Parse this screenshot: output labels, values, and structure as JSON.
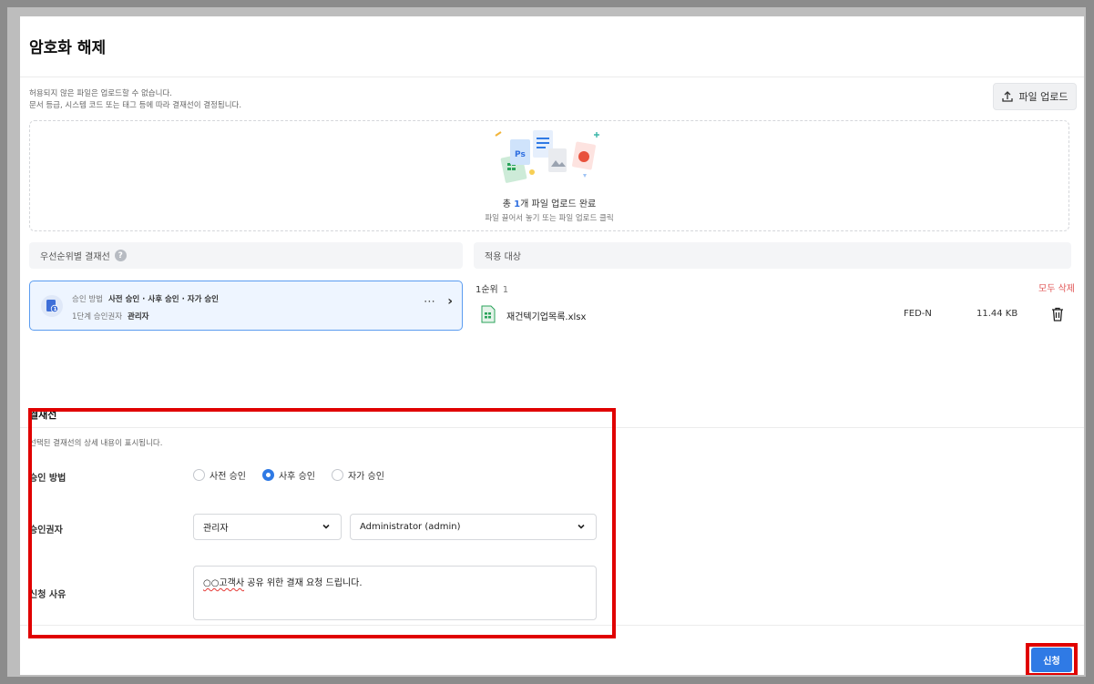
{
  "page": {
    "title": "암호화 해제",
    "notice_line1": "허용되지 않은 파일은 업로드할 수 없습니다.",
    "notice_line2": "문서 등급, 시스템 코드 또는 태그 등에 따라 결재선이 결정됩니다.",
    "upload_button": "파일 업로드"
  },
  "dropzone": {
    "status_prefix": "총 ",
    "status_count": "1",
    "status_suffix": "개 파일 업로드 완료",
    "hint": "파일 끌어서 놓기 또는 파일 업로드 클릭"
  },
  "approval_panel": {
    "header": "우선순위별 결재선",
    "card": {
      "method_label": "승인 방법",
      "method_value": "사전 승인 · 사후 승인 · 자가 승인",
      "approver_label": "1단계 승인권자",
      "approver_value": "관리자"
    }
  },
  "target_panel": {
    "header": "적용 대상",
    "rank_label": "1순위",
    "rank_count": "1",
    "delete_all": "모두 삭제",
    "files": [
      {
        "name": "재건텍기업목록.xlsx",
        "class": "FED-N",
        "size": "11.44 KB"
      }
    ]
  },
  "approval_line": {
    "title": "결재선",
    "description": "선택된 결재선의 상세 내용이 표시됩니다.",
    "method_label": "승인 방법",
    "methods": [
      {
        "label": "사전 승인",
        "selected": false
      },
      {
        "label": "사후 승인",
        "selected": true
      },
      {
        "label": "자가 승인",
        "selected": false
      }
    ],
    "approver_label": "승인권자",
    "approver_role": "관리자",
    "approver_user": "Administrator (admin)",
    "reason_label": "신청 사유",
    "reason_underlined": "○○고객사",
    "reason_rest": " 공유 위한 결재 요청 드립니다."
  },
  "actions": {
    "submit": "신청"
  },
  "colors": {
    "accent": "#2f7ae5",
    "danger": "#e05656",
    "highlight": "#e00000"
  }
}
